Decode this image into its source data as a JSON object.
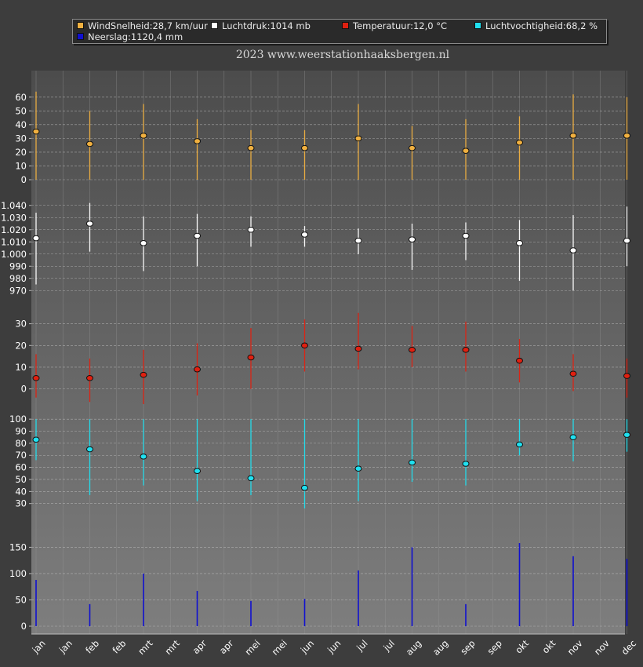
{
  "legend": [
    {
      "label": "WindSnelheid:28,7 km/uur",
      "color": "#f0b040"
    },
    {
      "label": "Luchtdruk:1014 mb",
      "color": "#ffffff"
    },
    {
      "label": "Temperatuur:12,0 °C",
      "color": "#e02010"
    },
    {
      "label": "Luchtvochtigheid:68,2 %",
      "color": "#20e0f0"
    },
    {
      "label": "Neerslag:1120,4 mm",
      "color": "#1010d0"
    }
  ],
  "subtitle": "2023  www.weerstationhaaksbergen.nl",
  "chart_data": {
    "type": "stacked-range-panels",
    "x_labels": [
      "jan",
      "jan",
      "feb",
      "feb",
      "mrt",
      "mrt",
      "apr",
      "apr",
      "mei",
      "mei",
      "jun",
      "jun",
      "jul",
      "jul",
      "aug",
      "aug",
      "sep",
      "sep",
      "okt",
      "okt",
      "nov",
      "nov",
      "dec"
    ],
    "month_slots": [
      0,
      2,
      4,
      6,
      8,
      10,
      12,
      14,
      16,
      18,
      20,
      22
    ],
    "panels": [
      {
        "name": "wind",
        "ylim": [
          0,
          65
        ],
        "ticks": [
          0,
          10,
          20,
          30,
          40,
          50,
          60
        ],
        "tick_labels": [
          "0",
          "10",
          "20",
          "30",
          "40",
          "50",
          "60"
        ],
        "color": "#f0b040",
        "mean": [
          35,
          26,
          32,
          28,
          23,
          23,
          30,
          23,
          21,
          27,
          32,
          32
        ],
        "low": [
          0,
          0,
          0,
          0,
          0,
          0,
          0,
          0,
          0,
          0,
          0,
          0
        ],
        "high": [
          64,
          50,
          55,
          44,
          36,
          36,
          55,
          39,
          44,
          46,
          62,
          60
        ]
      },
      {
        "name": "luchtdruk",
        "ylim": [
          965,
          1045
        ],
        "ticks": [
          970,
          980,
          990,
          1000,
          1010,
          1020,
          1030,
          1040
        ],
        "tick_labels": [
          "970",
          "980",
          "990",
          "1.000",
          "1.010",
          "1.020",
          "1.030",
          "1.040"
        ],
        "color": "#ffffff",
        "mean": [
          1013,
          1025,
          1009,
          1015,
          1020,
          1016,
          1011,
          1012,
          1015,
          1009,
          1003,
          1011
        ],
        "low": [
          975,
          1002,
          986,
          990,
          1006,
          1006,
          1000,
          987,
          995,
          978,
          970,
          990
        ],
        "high": [
          1034,
          1042,
          1031,
          1033,
          1031,
          1023,
          1021,
          1025,
          1026,
          1028,
          1032,
          1039
        ]
      },
      {
        "name": "temperatuur",
        "ylim": [
          -7,
          36
        ],
        "ticks": [
          0,
          10,
          20,
          30
        ],
        "tick_labels": [
          "0",
          "10",
          "20",
          "30"
        ],
        "color": "#e02010",
        "mean": [
          5,
          5,
          6.5,
          9,
          14.5,
          20,
          18.5,
          18,
          18,
          13,
          7,
          6
        ],
        "low": [
          -4,
          -6,
          -7,
          -3,
          0,
          8,
          9,
          10,
          8,
          3,
          -1,
          -4
        ],
        "high": [
          16,
          14,
          18,
          21,
          28,
          32,
          35,
          29,
          31,
          23,
          16,
          14
        ]
      },
      {
        "name": "luchtvochtigheid",
        "ylim": [
          22,
          104
        ],
        "ticks": [
          30,
          40,
          50,
          60,
          70,
          80,
          90,
          100
        ],
        "tick_labels": [
          "30",
          "40",
          "50",
          "60",
          "70",
          "80",
          "90",
          "100"
        ],
        "color": "#20e0f0",
        "mean": [
          83,
          75,
          69,
          57,
          51,
          43,
          59,
          64,
          63,
          79,
          85,
          87
        ],
        "low": [
          66,
          37,
          45,
          32,
          37,
          26,
          32,
          48,
          45,
          70,
          65,
          73
        ],
        "high": [
          100,
          100,
          100,
          100,
          100,
          100,
          100,
          100,
          100,
          100,
          100,
          100
        ]
      },
      {
        "name": "neerslag",
        "ylim": [
          0,
          170
        ],
        "ticks": [
          0,
          50,
          100,
          150
        ],
        "tick_labels": [
          "0",
          "50",
          "100",
          "150"
        ],
        "color": "#1010d0",
        "values": [
          88,
          42,
          100,
          67,
          48,
          52,
          106,
          150,
          42,
          158,
          133,
          128
        ]
      }
    ]
  }
}
